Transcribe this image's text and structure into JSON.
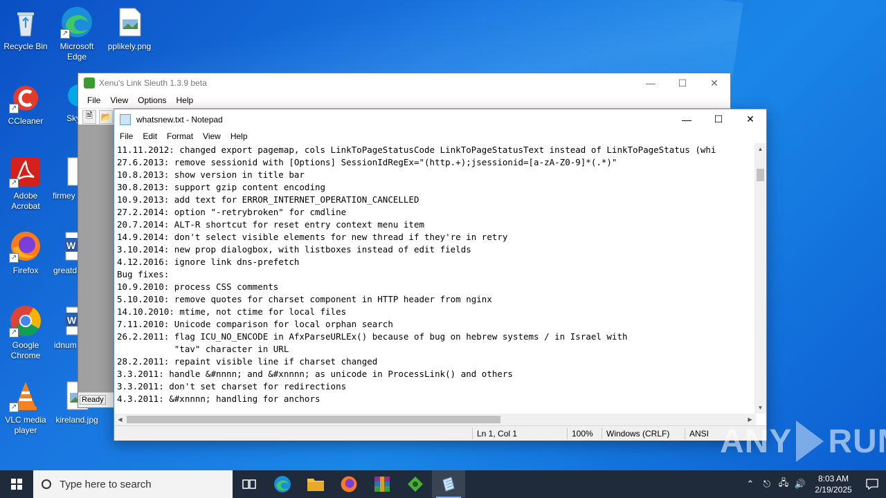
{
  "desktop_icons": [
    {
      "label": "Recycle Bin",
      "icon": "recycle-bin-icon"
    },
    {
      "label": "Microsoft Edge",
      "icon": "edge-icon"
    },
    {
      "label": "pplikely.png",
      "icon": "image-file-icon"
    },
    {
      "label": "CCleaner",
      "icon": "ccleaner-icon"
    },
    {
      "label": "Sky",
      "icon": "skype-icon"
    },
    {
      "label": "Adobe Acrobat",
      "icon": "acrobat-icon"
    },
    {
      "label": "firmey",
      "icon": "file-icon"
    },
    {
      "label": "Firefox",
      "icon": "firefox-icon"
    },
    {
      "label": "greatd",
      "icon": "word-doc-icon"
    },
    {
      "label": "Google Chrome",
      "icon": "chrome-icon"
    },
    {
      "label": "idnum",
      "icon": "word-doc-icon"
    },
    {
      "label": "VLC media player",
      "icon": "vlc-icon"
    },
    {
      "label": "kireland.jpg",
      "icon": "image-file-icon"
    }
  ],
  "xenu": {
    "title": "Xenu's Link Sleuth 1.3.9 beta",
    "menu": [
      "File",
      "View",
      "Options",
      "Help"
    ],
    "status": "Ready"
  },
  "notepad": {
    "title": "whatsnew.txt - Notepad",
    "menu": [
      "File",
      "Edit",
      "Format",
      "View",
      "Help"
    ],
    "lines": [
      "11.11.2012: changed export pagemap, cols LinkToPageStatusCode LinkToPageStatusText instead of LinkToPageStatus (whi",
      "27.6.2013: remove sessionid with [Options] SessionIdRegEx=\"(http.+);jsessionid=[a-zA-Z0-9]*(.*)\"",
      "10.8.2013: show version in title bar",
      "30.8.2013: support gzip content encoding",
      "10.9.2013: add text for ERROR_INTERNET_OPERATION_CANCELLED",
      "27.2.2014: option \"-retrybroken\" for cmdline",
      "20.7.2014: ALT-R shortcut for reset entry context menu item",
      "14.9.2014: don't select visible elements for new thread if they're in retry",
      "3.10.2014: new prop dialogbox, with listboxes instead of edit fields",
      "4.12.2016: ignore link dns-prefetch",
      "",
      "Bug fixes:",
      "10.9.2010: process CSS comments",
      "5.10.2010: remove quotes for charset component in HTTP header from nginx",
      "14.10.2010: mtime, not ctime for local files",
      "7.11.2010: Unicode comparison for local orphan search",
      "26.2.2011: flag ICU_NO_ENCODE in AfxParseURLEx() because of bug on hebrew systems / in Israel with",
      "           \"tav\" character in URL",
      "28.2.2011: repaint visible line if charset changed",
      "3.3.2011: handle &#nnnn; and &#xnnnn; as unicode in ProcessLink() and others",
      "3.3.2011: don't set charset for redirections",
      "4.3.2011: &#xnnnn; handling for anchors"
    ],
    "status": {
      "position": "Ln 1, Col 1",
      "zoom": "100%",
      "line_ending": "Windows (CRLF)",
      "encoding": "ANSI"
    }
  },
  "watermark": {
    "left": "ANY",
    "right": "RUN"
  },
  "taskbar": {
    "search_placeholder": "Type here to search",
    "apps": [
      "task-view-icon",
      "edge-icon",
      "file-explorer-icon",
      "firefox-icon",
      "winrar-icon",
      "xenu-icon",
      "notepad-icon"
    ],
    "time": "8:03 AM",
    "date": "2/19/2025"
  }
}
